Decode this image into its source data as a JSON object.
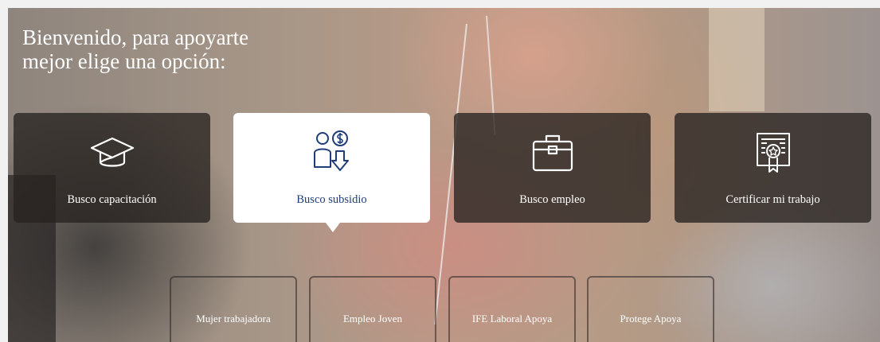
{
  "headline": {
    "line1": "Bienvenido, para apoyarte",
    "line2": "mejor elige una opción:"
  },
  "cards": [
    {
      "label": "Busco capacitación",
      "icon": "graduation-cap-icon"
    },
    {
      "label": "Busco subsidio",
      "icon": "person-money-icon",
      "active": true
    },
    {
      "label": "Busco empleo",
      "icon": "briefcase-icon"
    },
    {
      "label": "Certificar mi trabajo",
      "icon": "certificate-icon"
    }
  ],
  "programs": [
    {
      "label": "Mujer trabajadora"
    },
    {
      "label": "Empleo Joven"
    },
    {
      "label": "IFE Laboral Apoya"
    },
    {
      "label": "Protege Apoya"
    }
  ],
  "colors": {
    "active_text": "#1f3d79",
    "card_bg": "#282220",
    "text": "#ffffff"
  }
}
